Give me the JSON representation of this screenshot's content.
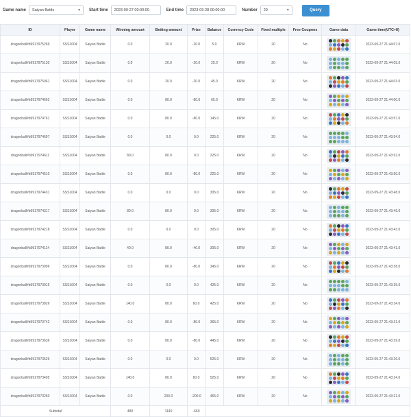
{
  "filters": {
    "game_name_label": "Game name",
    "game_name_value": "Saiyan Battle",
    "start_time_label": "Start time",
    "start_time_value": "2023-09-27 00:00:00",
    "end_time_label": "End time",
    "end_time_value": "2023-09-28 00:00:00",
    "number_label": "Number",
    "number_value": "20",
    "query_label": "Query"
  },
  "table": {
    "headers": [
      "ID",
      "Player",
      "Game name",
      "Winning amount",
      "Betting amount",
      "Prize",
      "Balance",
      "Currency Code",
      "Fixed multiple",
      "Free Coupons",
      "Game data",
      "Game time(UTC+8)"
    ],
    "rows": [
      [
        "dragonball#b9917975269",
        "SSS1004",
        "Saiyan Battle",
        "0.0",
        "20.0",
        "-20.0",
        "5.0",
        "KRW",
        "20",
        "No",
        "2023-09-27 21:44:07.0"
      ],
      [
        "dragonball#b9917975130",
        "SSS1004",
        "Saiyan Battle",
        "0.0",
        "20.0",
        "-20.0",
        "25.0",
        "KRW",
        "20",
        "No",
        "2023-09-27 21:44:05.0"
      ],
      [
        "dragonball#b9917975061",
        "SSS1004",
        "Saiyan Battle",
        "0.0",
        "20.0",
        "-20.0",
        "45.0",
        "KRW",
        "20",
        "No",
        "2023-09-27 21:44:03.0"
      ],
      [
        "dragonball#b9917974692",
        "SSS1004",
        "Saiyan Battle",
        "0.0",
        "80.0",
        "-80.0",
        "65.0",
        "KRW",
        "20",
        "No",
        "2023-09-27 21:44:00.0"
      ],
      [
        "dragonball#b9917974761",
        "SSS1004",
        "Saiyan Battle",
        "0.0",
        "80.0",
        "-80.0",
        "145.0",
        "KRW",
        "20",
        "No",
        "2023-09-27 21:43:57.0"
      ],
      [
        "dragonball#b9917974697",
        "SSS1004",
        "Saiyan Battle",
        "0.0",
        "0.0",
        "0.0",
        "225.0",
        "KRW",
        "20",
        "No",
        "2023-09-27 21:43:54.0"
      ],
      [
        "dragonball#b9917974611",
        "SSS1004",
        "Saiyan Battle",
        "80.0",
        "80.0",
        "0.0",
        "225.0",
        "KRW",
        "20",
        "No",
        "2023-09-27 21:43:52.0"
      ],
      [
        "dragonball#b9917974510",
        "SSS1004",
        "Saiyan Battle",
        "0.0",
        "80.0",
        "-80.0",
        "225.0",
        "KRW",
        "20",
        "No",
        "2023-09-27 21:43:50.0"
      ],
      [
        "dragonball#b9917974431",
        "SSS1004",
        "Saiyan Battle",
        "0.0",
        "0.0",
        "0.0",
        "305.0",
        "KRW",
        "20",
        "No",
        "2023-09-27 21:43:48.0"
      ],
      [
        "dragonball#b9917974317",
        "SSS1004",
        "Saiyan Battle",
        "80.0",
        "80.0",
        "0.0",
        "305.0",
        "KRW",
        "20",
        "No",
        "2023-09-27 21:43:46.0"
      ],
      [
        "dragonball#b9917974218",
        "SSS1004",
        "Saiyan Battle",
        "0.0",
        "0.0",
        "0.0",
        "305.0",
        "KRW",
        "20",
        "No",
        "2023-09-27 21:43:43.0"
      ],
      [
        "dragonball#b9917974114",
        "SSS1004",
        "Saiyan Battle",
        "40.0",
        "80.0",
        "-40.0",
        "305.0",
        "KRW",
        "20",
        "No",
        "2023-09-27 21:43:41.0"
      ],
      [
        "dragonball#b9917973996",
        "SSS1004",
        "Saiyan Battle",
        "0.0",
        "80.0",
        "-80.0",
        "345.0",
        "KRW",
        "20",
        "No",
        "2023-09-27 21:43:38.0"
      ],
      [
        "dragonball#b9917973915",
        "SSS1004",
        "Saiyan Battle",
        "0.0",
        "0.0",
        "0.0",
        "425.0",
        "KRW",
        "20",
        "No",
        "2023-09-27 21:43:35.0"
      ],
      [
        "dragonball#b9917973826",
        "SSS1004",
        "Saiyan Battle",
        "140.0",
        "80.0",
        "60.0",
        "425.0",
        "KRW",
        "20",
        "No",
        "2023-09-27 21:43:34.0"
      ],
      [
        "dragonball#b9917973742",
        "SSS1004",
        "Saiyan Battle",
        "0.0",
        "80.0",
        "-80.0",
        "365.0",
        "KRW",
        "20",
        "No",
        "2023-09-27 21:43:31.0"
      ],
      [
        "dragonball#b9917973636",
        "SSS1004",
        "Saiyan Battle",
        "0.0",
        "80.0",
        "-80.0",
        "445.0",
        "KRW",
        "20",
        "No",
        "2023-09-27 21:43:29.0"
      ],
      [
        "dragonball#b9917973529",
        "SSS1004",
        "Saiyan Battle",
        "0.0",
        "0.0",
        "0.0",
        "525.0",
        "KRW",
        "20",
        "No",
        "2023-09-27 21:43:26.0"
      ],
      [
        "dragonball#b9917973405",
        "SSS1004",
        "Saiyan Battle",
        "140.0",
        "80.0",
        "60.0",
        "525.0",
        "KRW",
        "20",
        "No",
        "2023-09-27 21:43:24.0"
      ],
      [
        "dragonball#b9917973260",
        "SSS1004",
        "Saiyan Battle",
        "0.0",
        "200.0",
        "-200.0",
        "465.0",
        "KRW",
        "20",
        "No",
        "2023-09-27 21:43:21.0"
      ]
    ],
    "subtotal": {
      "label": "Subtotal",
      "winning": "480",
      "betting": "1140",
      "prize": "-660"
    }
  },
  "colors": {
    "accent": "#3c8fd1",
    "symbols": [
      "#2b2b2b",
      "#d9a520",
      "#3a73c4",
      "#5aa55a",
      "#c44a4a",
      "#8a5bc0",
      "#e07b2a",
      "#7fb4d8"
    ]
  }
}
